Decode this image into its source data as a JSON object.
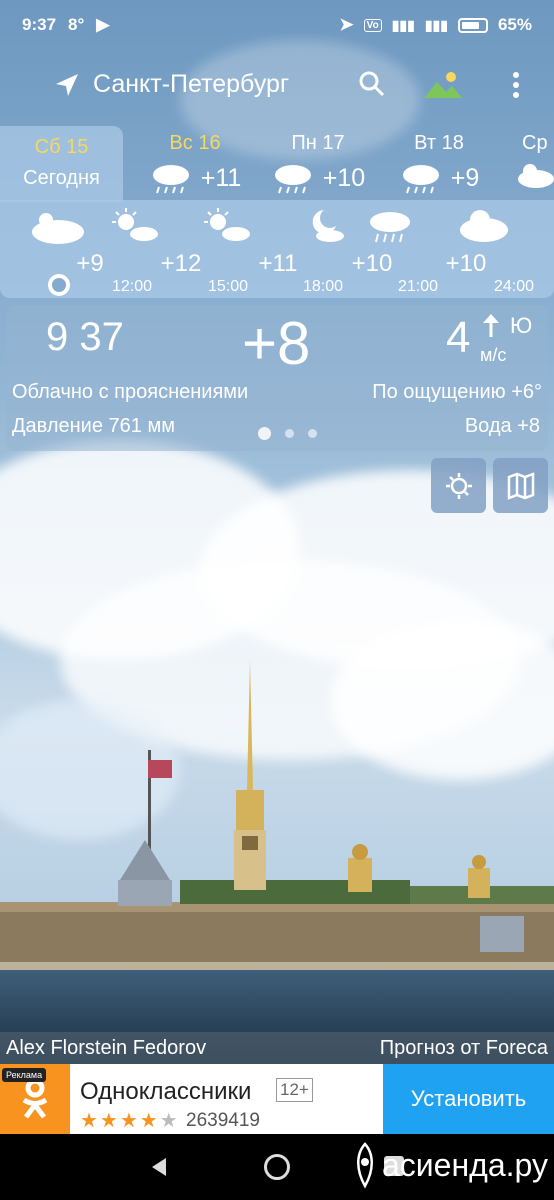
{
  "status": {
    "time": "9:37",
    "temp": "8°",
    "battery": "65%"
  },
  "appbar": {
    "city": "Санкт-Петербург"
  },
  "days": [
    {
      "name": "Сб 15",
      "sub": "Сегодня",
      "selected": true
    },
    {
      "name": "Вс 16",
      "temp": "+11"
    },
    {
      "name": "Пн 17",
      "temp": "+10"
    },
    {
      "name": "Вт 18",
      "temp": "+9"
    },
    {
      "name": "Ср"
    }
  ],
  "hourly": {
    "temps": [
      "+9",
      "+12",
      "+11",
      "+10",
      "+10"
    ],
    "times": [
      "12:00",
      "15:00",
      "18:00",
      "21:00",
      "24:00"
    ]
  },
  "current": {
    "time": "9 37",
    "temp": "+8",
    "wind_speed": "4",
    "wind_dir": "Ю",
    "wind_unit": "м/с",
    "description": "Облачно с прояснениями",
    "feels_like": "По ощущению +6°",
    "pressure": "Давление 761 мм",
    "water": "Вода +8"
  },
  "credits": {
    "photo": "Alex Florstein Fedorov",
    "forecast": "Прогноз от Foreca"
  },
  "ad": {
    "badge": "Реклама",
    "title": "Одноклассники",
    "age": "12+",
    "rating_count": "2639419",
    "rating": 4,
    "install": "Установить"
  },
  "watermark": "асиенда.ру",
  "colors": {
    "accent_yellow": "#f6d860",
    "install_blue": "#1fa2f2",
    "ok_orange": "#f7931e"
  }
}
